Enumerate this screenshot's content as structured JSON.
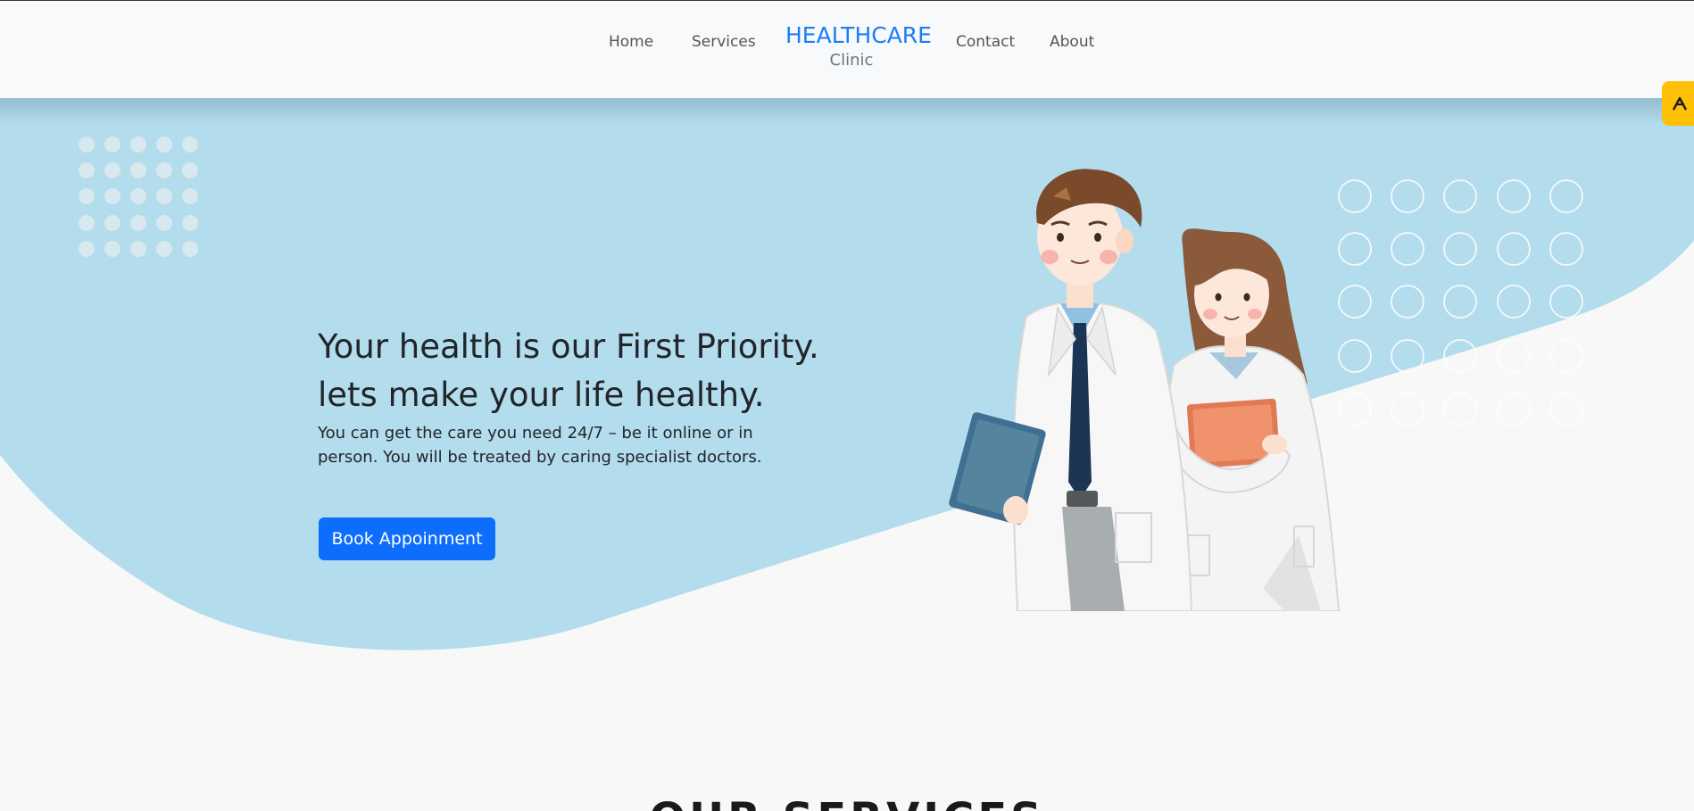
{
  "nav": {
    "links_left": [
      "Home",
      "Services"
    ],
    "links_right": [
      "Contact",
      "About"
    ],
    "brand_title": "HEALTHCARE",
    "brand_subtitle": "Clinic"
  },
  "hero": {
    "heading_line1": "Your health is our First Priority.",
    "heading_line2": "lets make your life healthy.",
    "description": "You can get the care you need 24/7 – be it online or in person. You will be treated by caring specialist doctors.",
    "cta_label": "Book Appoinment"
  },
  "section": {
    "title": "OUR SERVICES"
  },
  "widget": {
    "icon": "accessibility-icon"
  },
  "illustration": {
    "icon": "doctors-illustration"
  },
  "colors": {
    "brand_blue": "#1b7ef5",
    "button_blue": "#0d6efd",
    "hero_bg": "#b3dcec",
    "widget_yellow": "#ffc107"
  }
}
